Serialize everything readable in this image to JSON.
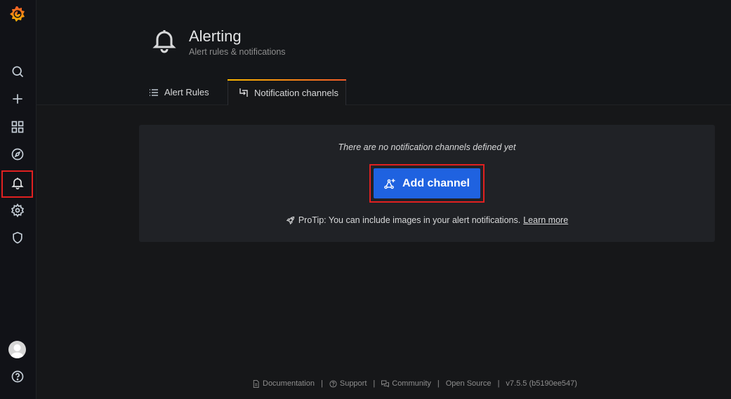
{
  "header": {
    "title": "Alerting",
    "subtitle": "Alert rules & notifications",
    "icon": "bell-icon"
  },
  "tabs": [
    {
      "label": "Alert Rules",
      "icon": "list-icon",
      "active": false
    },
    {
      "label": "Notification channels",
      "icon": "channel-icon",
      "active": true
    }
  ],
  "sidebar": {
    "items": [
      {
        "name": "search",
        "icon": "search-icon"
      },
      {
        "name": "create",
        "icon": "plus-icon"
      },
      {
        "name": "dashboards",
        "icon": "apps-icon"
      },
      {
        "name": "explore",
        "icon": "compass-icon"
      },
      {
        "name": "alerting",
        "icon": "bell-icon",
        "active": true
      },
      {
        "name": "configuration",
        "icon": "gear-icon"
      },
      {
        "name": "server-admin",
        "icon": "shield-icon"
      }
    ]
  },
  "empty_state": {
    "message": "There are no notification channels defined yet",
    "button_label": "Add channel",
    "protip": "ProTip: You can include images in your alert notifications.",
    "learn_more": "Learn more"
  },
  "footer": {
    "documentation": "Documentation",
    "support": "Support",
    "community": "Community",
    "open_source": "Open Source",
    "version": "v7.5.5 (b5190ee547)",
    "separator": "|"
  },
  "colors": {
    "accent": "#1f62e0",
    "highlight": "#e02020",
    "tab_gradient_start": "#f9b600",
    "tab_gradient_end": "#f05a28"
  }
}
